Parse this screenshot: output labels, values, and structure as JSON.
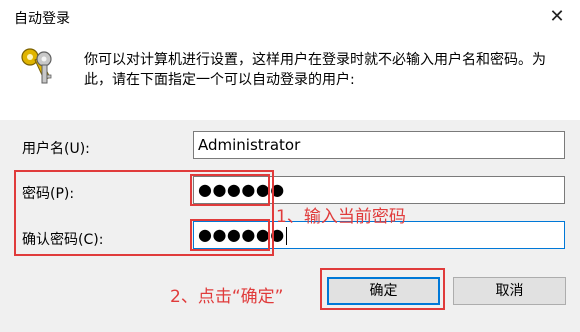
{
  "window": {
    "title": "自动登录",
    "close_glyph": "✕"
  },
  "description": "你可以对计算机进行设置，这样用户在登录时就不必输入用户名和密码。为此，请在下面指定一个可以自动登录的用户:",
  "fields": {
    "username": {
      "label": "用户名(U):",
      "value": "Administrator"
    },
    "password": {
      "label": "密码(P):",
      "value": "●●●●●●"
    },
    "confirm": {
      "label": "确认密码(C):",
      "value": "●●●●●●"
    }
  },
  "buttons": {
    "ok": "确定",
    "cancel": "取消"
  },
  "annotations": {
    "step1": "1、输入当前密码",
    "step2": "2、点击“确定”",
    "color": "#e03b3b"
  },
  "colors": {
    "focus": "#0078d7",
    "dialog_bg": "#f0f0f0"
  }
}
